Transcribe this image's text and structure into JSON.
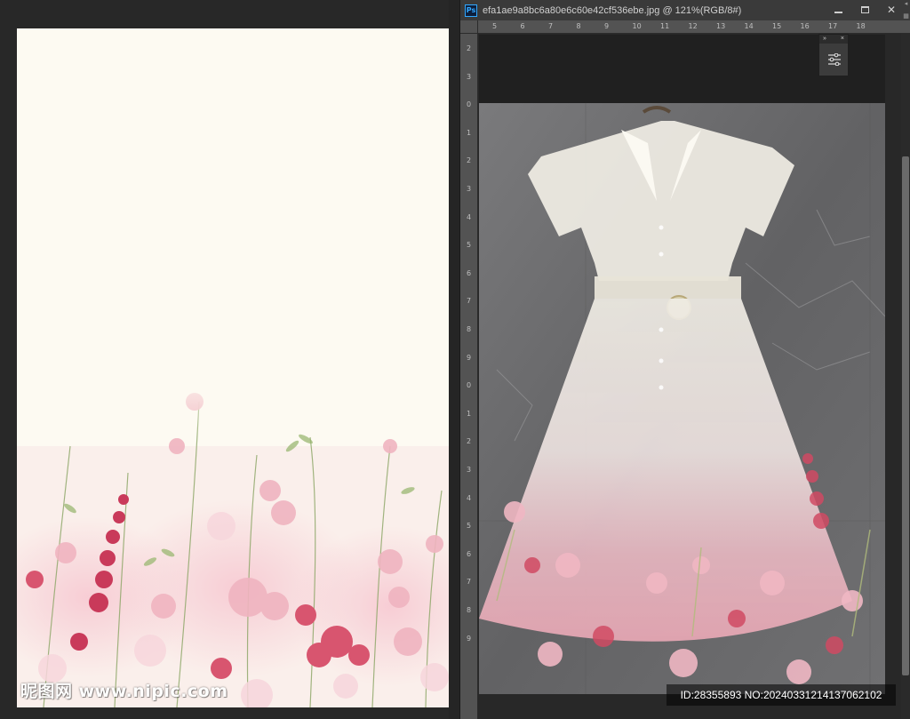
{
  "document": {
    "ps_badge": "Ps",
    "title": "efa1ae9a8bc6a80e6c60e42cf536ebe.jpg @ 121%(RGB/8#)"
  },
  "window_controls": {
    "minimize_icon": "minimize-icon",
    "maximize_icon": "maximize-icon",
    "close_icon": "close-icon",
    "close_glyph": "✕"
  },
  "ruler": {
    "horizontal_ticks": [
      "5",
      "6",
      "7",
      "8",
      "9",
      "10",
      "11",
      "12",
      "13",
      "14",
      "15",
      "16",
      "17",
      "18"
    ],
    "vertical_ticks": [
      "2",
      "3",
      "0",
      "1",
      "2",
      "3",
      "4",
      "5",
      "6",
      "7",
      "8",
      "9",
      "0",
      "1",
      "2",
      "3",
      "4",
      "5",
      "6",
      "7",
      "8",
      "9"
    ]
  },
  "panel": {
    "expand_glyph": "»",
    "close_glyph": "×",
    "properties_icon": "sliders-icon"
  },
  "watermark": {
    "left_text": "昵图网 www.nipic.com"
  },
  "caption": {
    "id_text": "ID:28355893 NO:20240331214137062102"
  },
  "colors": {
    "workspace": "#282828",
    "canvas": "#fdfaf2",
    "titlebar": "#3a3a3a",
    "ruler": "#535353",
    "ps_blue": "#31a8ff"
  }
}
